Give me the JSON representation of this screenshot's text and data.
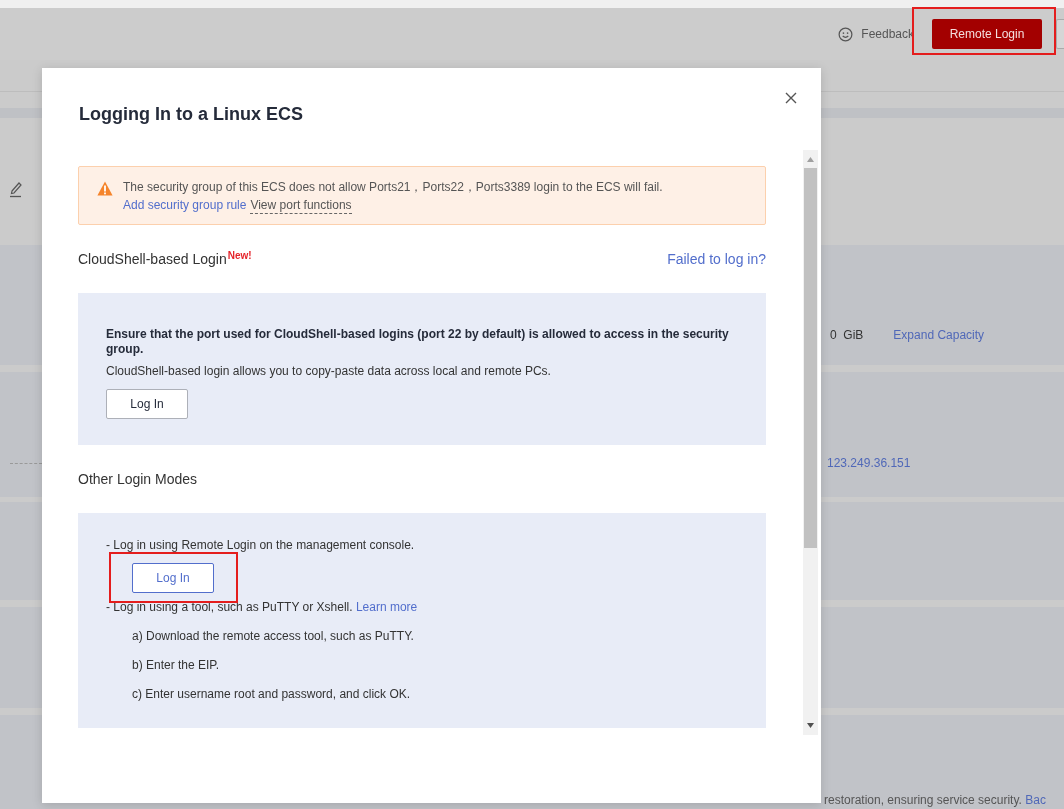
{
  "header": {
    "feedback": "Feedback",
    "buttons": [
      {
        "label": "Remote Login",
        "highlighted": true
      }
    ]
  },
  "background_fields": [
    {
      "value": "0  GiB",
      "link": "Expand Capacity"
    },
    {
      "link": "123.249.36.151"
    }
  ],
  "background_note": {
    "text": "restoration, ensuring service security.",
    "link": "Bac"
  },
  "dialog": {
    "title": "Logging In to a Linux ECS",
    "alert": {
      "message": "The security group of this ECS does not allow Ports21，Ports22，Ports3389 login to the ECS will fail.",
      "links": [
        {
          "label": "Add security group rule",
          "kind": "link"
        },
        {
          "label": "View port functions",
          "kind": "tip"
        }
      ]
    },
    "sections": [
      {
        "title": "CloudShell-based Login",
        "badge": "New!",
        "help_link": "Failed to log in?",
        "items": [
          {
            "kind": "bold",
            "text": "Ensure that the port used for CloudShell-based logins (port 22 by default) is allowed to access in the security group."
          },
          {
            "kind": "text",
            "text": "CloudShell-based login allows you to copy-paste data across local and remote PCs."
          },
          {
            "kind": "button",
            "label": "Log In",
            "highlighted": false
          }
        ]
      },
      {
        "title": "Other Login Modes",
        "items": [
          {
            "kind": "text",
            "text": "- Log in using Remote Login on the management console."
          },
          {
            "kind": "outlinebutton",
            "label": "Log In",
            "highlighted": true
          },
          {
            "kind": "text",
            "text": "- Log in using a tool, such as PuTTY or Xshell.",
            "link": "Learn more"
          },
          {
            "kind": "step",
            "text": "a) Download the remote access tool, such as PuTTY."
          },
          {
            "kind": "step",
            "text": "b) Enter the EIP."
          },
          {
            "kind": "step",
            "text": "c) Enter username root and password, and click OK."
          }
        ]
      }
    ]
  }
}
